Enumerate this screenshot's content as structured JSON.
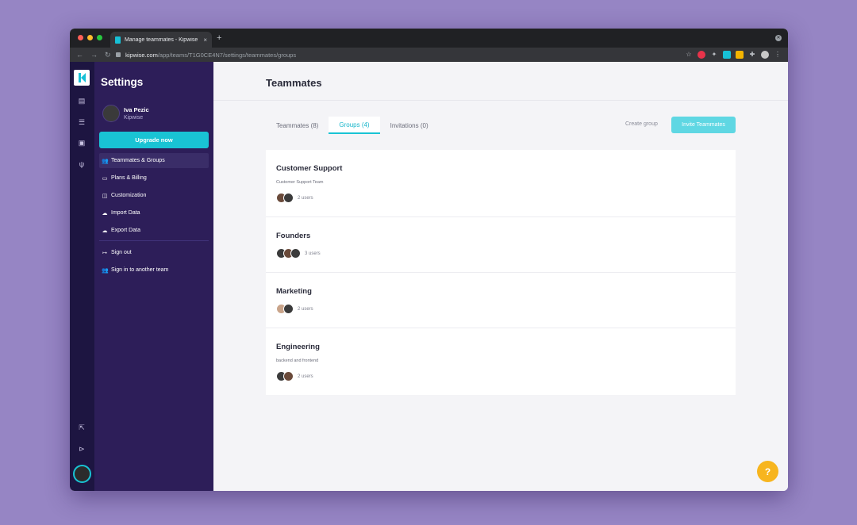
{
  "browser": {
    "tab_title": "Manage teammates - Kipwise",
    "tab_close": "×",
    "new_tab": "+",
    "url_host": "kipwise.com",
    "url_path": "/app/teams/T1G0CE4N7/settings/teammates/groups",
    "traffic_lights": [
      "#ff5f57",
      "#febc2e",
      "#28c840"
    ]
  },
  "rail": {
    "icons": [
      "books-icon",
      "list-icon",
      "image-icon",
      "plug-icon",
      "export-icon",
      "megaphone-icon"
    ]
  },
  "sidebar": {
    "title": "Settings",
    "profile": {
      "name": "Iva Pezic",
      "team": "Kipwise"
    },
    "upgrade_label": "Upgrade now",
    "items": [
      {
        "label": "Teammates & Groups",
        "icon": "people-icon",
        "glyph": "👥"
      },
      {
        "label": "Plans & Billing",
        "icon": "credit-card-icon",
        "glyph": "▭"
      },
      {
        "label": "Customization",
        "icon": "customize-icon",
        "glyph": "◫"
      },
      {
        "label": "Import Data",
        "icon": "cloud-upload-icon",
        "glyph": "☁"
      },
      {
        "label": "Export Data",
        "icon": "cloud-download-icon",
        "glyph": "☁"
      },
      {
        "label": "Sign out",
        "icon": "sign-out-icon",
        "glyph": "↦"
      },
      {
        "label": "Sign in to another team",
        "icon": "switch-team-icon",
        "glyph": "👥"
      }
    ]
  },
  "main": {
    "title": "Teammates",
    "tabs": [
      {
        "label": "Teammates (8)"
      },
      {
        "label": "Groups (4)"
      },
      {
        "label": "Invitations (0)"
      }
    ],
    "create_group_label": "Create group",
    "invite_label": "Invite Teammates",
    "groups": [
      {
        "name": "Customer Support",
        "description": "Customer Support Team",
        "users_label": "2 users"
      },
      {
        "name": "Founders",
        "description": "",
        "users_label": "3 users"
      },
      {
        "name": "Marketing",
        "description": "",
        "users_label": "2 users"
      },
      {
        "name": "Engineering",
        "description": "backend and frontend",
        "users_label": "2 users"
      }
    ],
    "help_label": "?"
  },
  "colors": {
    "accent": "#19c3d4",
    "sidebar_bg": "#2d1e59",
    "rail_bg": "#1d1541",
    "help_bg": "#f7b51f",
    "page_bg": "#9685c4"
  }
}
